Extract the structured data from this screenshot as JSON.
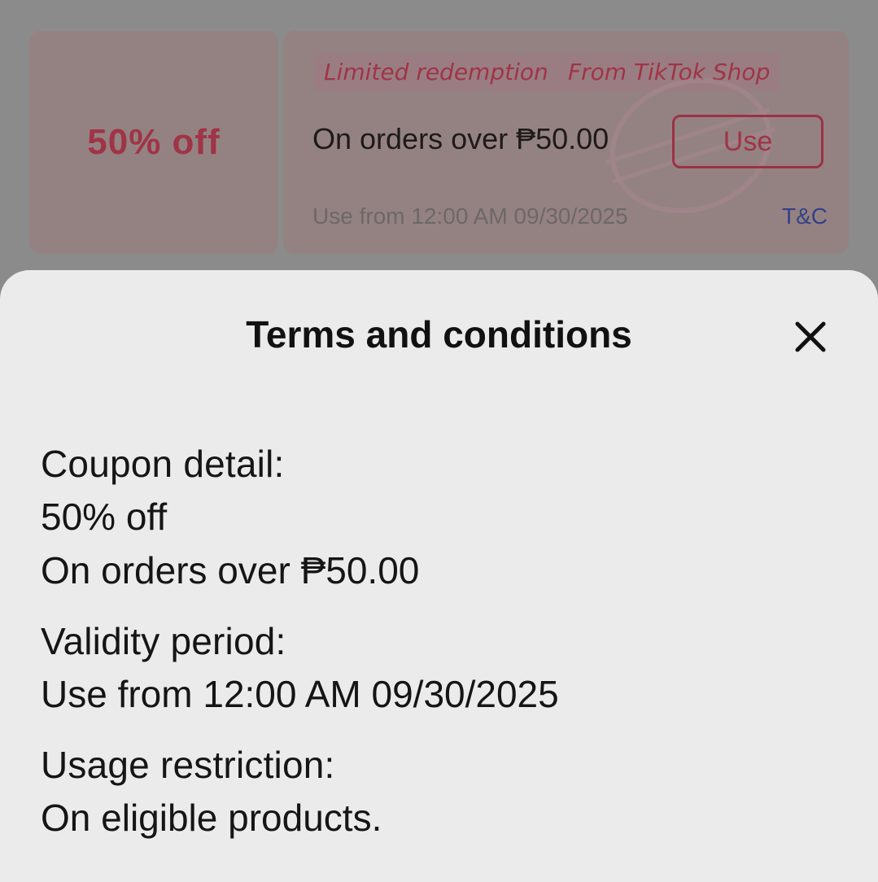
{
  "coupon": {
    "amount": "50% off",
    "tags": [
      "Limited redemption",
      "From TikTok Shop"
    ],
    "condition": "On orders over ₱50.00",
    "use_label": "Use",
    "validity": "Use from 12:00 AM 09/30/2025",
    "tnc_label": "T&C"
  },
  "sheet": {
    "title": "Terms and conditions",
    "close_icon": "close-icon",
    "sections": [
      {
        "heading": "Coupon detail:",
        "lines": [
          "50% off",
          "On orders over ₱50.00"
        ]
      },
      {
        "heading": "Validity period:",
        "lines": [
          "Use from 12:00 AM 09/30/2025"
        ]
      },
      {
        "heading": "Usage restriction:",
        "lines": [
          "On eligible products."
        ]
      }
    ]
  },
  "colors": {
    "accent": "#a03447",
    "link": "#334188",
    "overlay": "#8b8b8b",
    "sheet_background": "#ebebeb"
  }
}
